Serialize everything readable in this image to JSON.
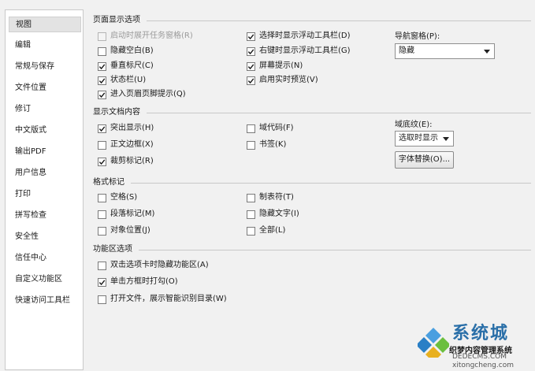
{
  "sidebar": {
    "items": [
      {
        "label": "视图"
      },
      {
        "label": "编辑"
      },
      {
        "label": "常规与保存"
      },
      {
        "label": "文件位置"
      },
      {
        "label": "修订"
      },
      {
        "label": "中文版式"
      },
      {
        "label": "输出PDF"
      },
      {
        "label": "用户信息"
      },
      {
        "label": "打印"
      },
      {
        "label": "拼写检查"
      },
      {
        "label": "安全性"
      },
      {
        "label": "信任中心"
      },
      {
        "label": "自定义功能区"
      },
      {
        "label": "快速访问工具栏"
      }
    ]
  },
  "page_display": {
    "header": "页面显示选项",
    "left": [
      {
        "label": "启动时展开任务窗格(R)",
        "checked": false,
        "disabled": true
      },
      {
        "label": "隐藏空白(B)",
        "checked": false
      },
      {
        "label": "垂直标尺(C)",
        "checked": true
      },
      {
        "label": "状态栏(U)",
        "checked": true
      },
      {
        "label": "进入页眉页脚提示(Q)",
        "checked": true
      }
    ],
    "right": [
      {
        "label": "选择时显示浮动工具栏(D)",
        "checked": true
      },
      {
        "label": "右键时显示浮动工具栏(G)",
        "checked": true
      },
      {
        "label": "屏幕提示(N)",
        "checked": true
      },
      {
        "label": "启用实时预览(V)",
        "checked": true
      }
    ],
    "nav_pane_label": "导航窗格(P):",
    "nav_pane_value": "隐藏"
  },
  "doc_content": {
    "header": "显示文档内容",
    "left": [
      {
        "label": "突出显示(H)",
        "checked": true
      },
      {
        "label": "正文边框(X)",
        "checked": false
      },
      {
        "label": "裁剪标记(R)",
        "checked": true
      }
    ],
    "right": [
      {
        "label": "域代码(F)",
        "checked": false
      },
      {
        "label": "书签(K)",
        "checked": false
      }
    ],
    "field_shading_label": "域底纹(E):",
    "field_shading_value": "选取时显示",
    "font_sub_button": "字体替换(O)..."
  },
  "format_marks": {
    "header": "格式标记",
    "left": [
      {
        "label": "空格(S)",
        "checked": false
      },
      {
        "label": "段落标记(M)",
        "checked": false
      },
      {
        "label": "对象位置(J)",
        "checked": false
      }
    ],
    "right": [
      {
        "label": "制表符(T)",
        "checked": false
      },
      {
        "label": "隐藏文字(I)",
        "checked": false
      },
      {
        "label": "全部(L)",
        "checked": false
      }
    ]
  },
  "ribbon": {
    "header": "功能区选项",
    "items": [
      {
        "label": "双击选项卡时隐藏功能区(A)",
        "checked": false
      },
      {
        "label": "单击方框时打勾(O)",
        "checked": true
      },
      {
        "label": "打开文件，展示智能识别目录(W)",
        "checked": false
      }
    ]
  },
  "watermark": {
    "line1": "系统城",
    "line2": "织梦内容管理系统",
    "line3": "DEDECMS.COM",
    "line4": "xitongcheng.com"
  },
  "colors": {
    "accent_blue": "#2a7fc6",
    "check": "#1a1a1a"
  }
}
